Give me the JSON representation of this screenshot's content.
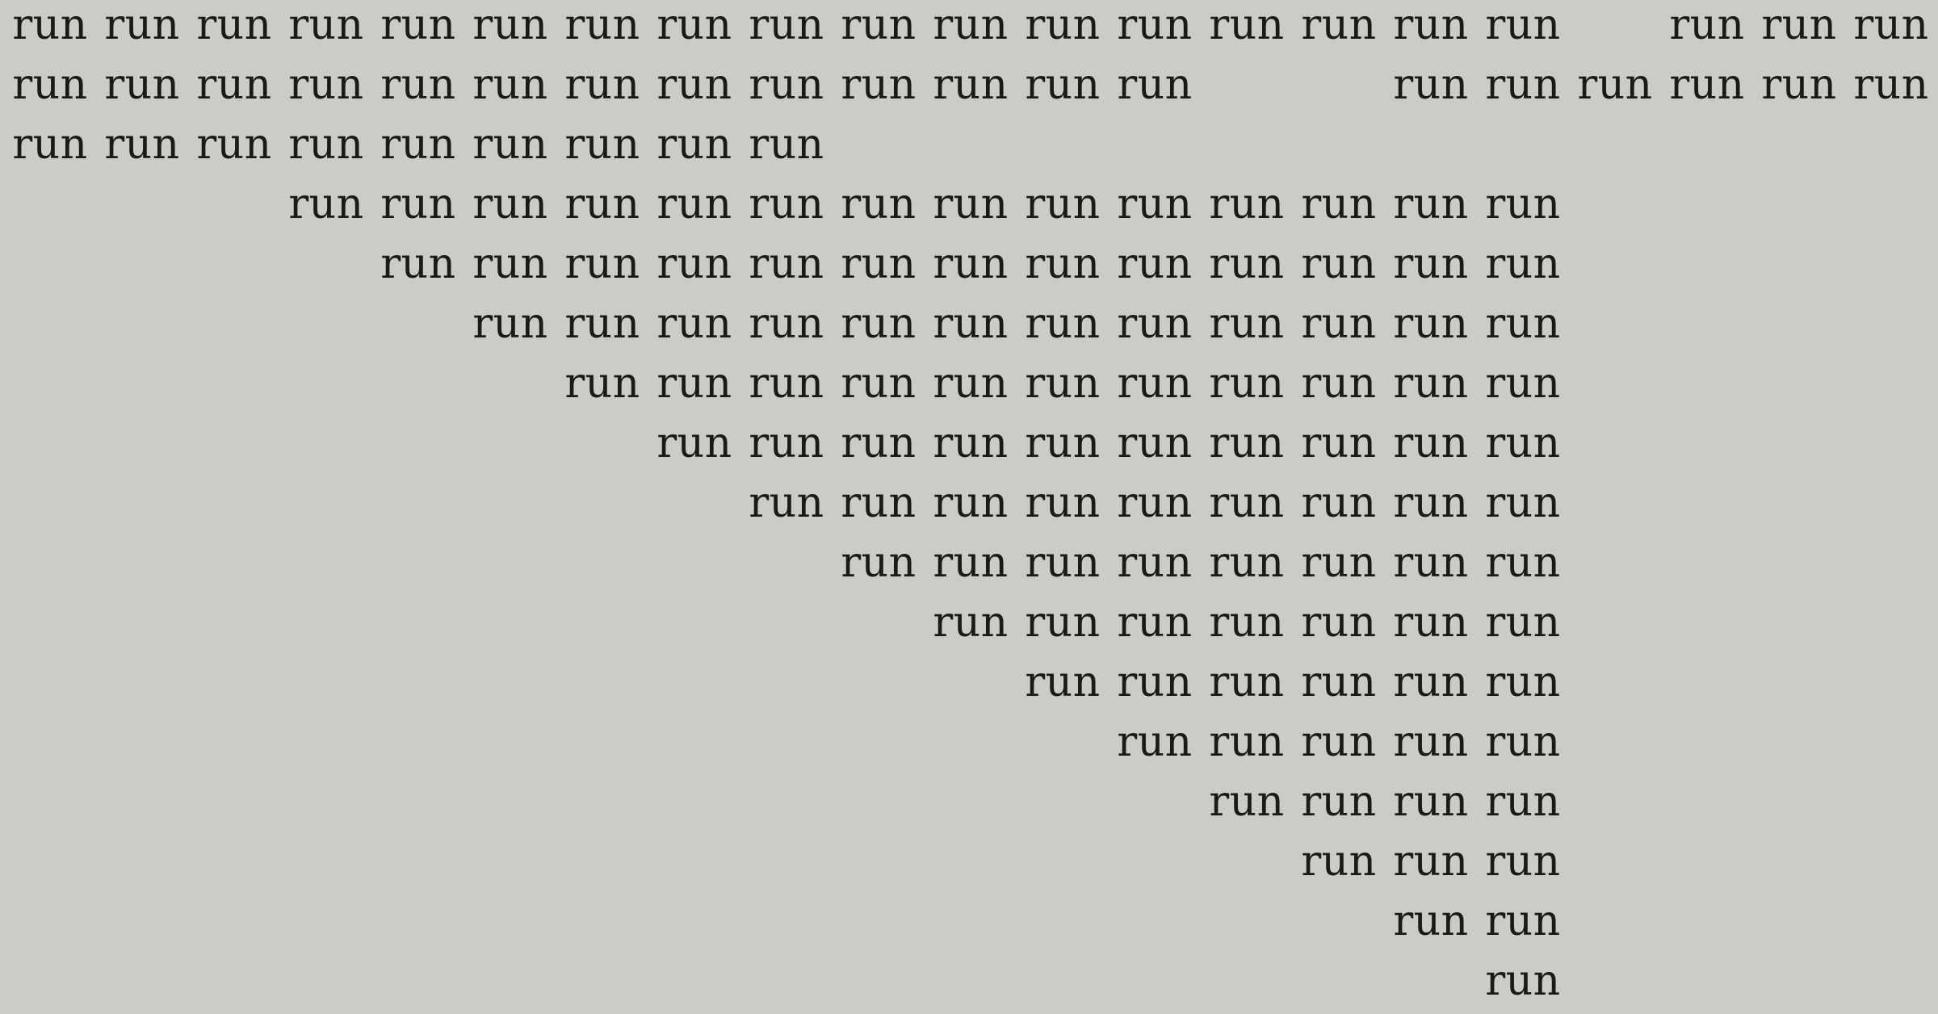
{
  "word": "run",
  "background_color": "#cbccc6",
  "text_color": "#1a1a1a",
  "lines": [
    {
      "id": "line-1",
      "counts": [
        17,
        3
      ]
    },
    {
      "id": "line-2",
      "counts": [
        13,
        6
      ]
    },
    {
      "id": "line-3",
      "counts": [
        9
      ]
    },
    {
      "id": "line-4",
      "counts": [
        14
      ]
    },
    {
      "id": "line-5",
      "counts": [
        13
      ]
    },
    {
      "id": "line-6",
      "counts": [
        12
      ]
    },
    {
      "id": "line-7",
      "counts": [
        11
      ]
    },
    {
      "id": "line-8",
      "counts": [
        10
      ]
    },
    {
      "id": "line-9",
      "counts": [
        9
      ]
    },
    {
      "id": "line-10",
      "counts": [
        8
      ]
    },
    {
      "id": "line-11",
      "counts": [
        7
      ]
    },
    {
      "id": "line-12",
      "counts": [
        6
      ]
    },
    {
      "id": "line-13",
      "counts": [
        5
      ]
    },
    {
      "id": "line-14",
      "counts": [
        4
      ]
    },
    {
      "id": "line-15",
      "counts": [
        3
      ]
    },
    {
      "id": "line-16",
      "counts": [
        2
      ]
    },
    {
      "id": "line-17",
      "counts": [
        1
      ]
    }
  ]
}
